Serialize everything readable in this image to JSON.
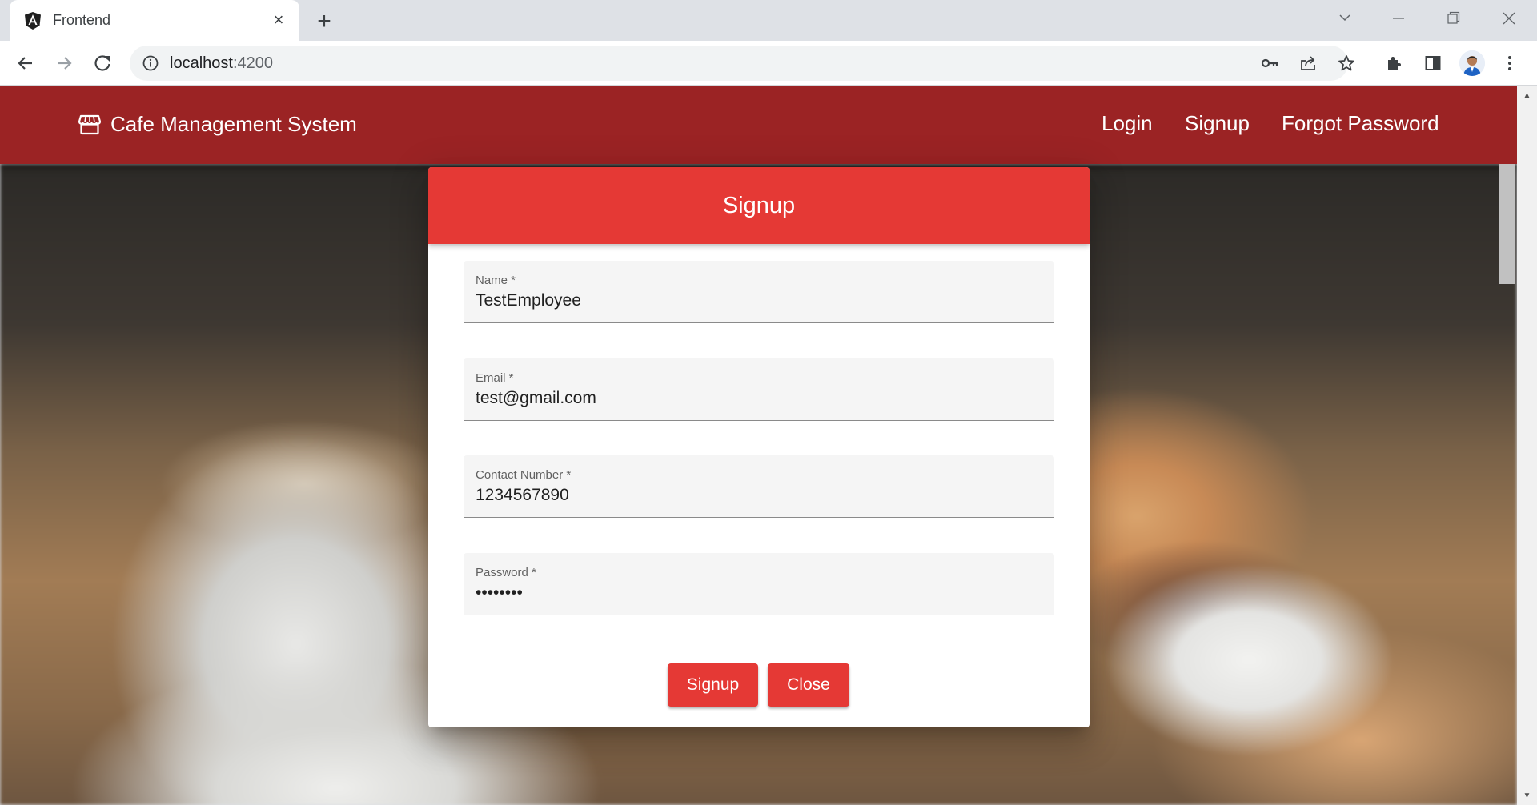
{
  "browser": {
    "tab_title": "Frontend",
    "url_host": "localhost",
    "url_port": ":4200"
  },
  "app": {
    "brand_title": "Cafe Management System",
    "nav": [
      "Login",
      "Signup",
      "Forgot Password"
    ]
  },
  "dialog": {
    "title": "Signup",
    "fields": [
      {
        "label": "Name *",
        "value": "TestEmployee",
        "type": "text"
      },
      {
        "label": "Email *",
        "value": "test@gmail.com",
        "type": "text"
      },
      {
        "label": "Contact Number *",
        "value": "1234567890",
        "type": "text"
      },
      {
        "label": "Password *",
        "value": "••••••••",
        "type": "password"
      }
    ],
    "buttons": {
      "signup": "Signup",
      "close": "Close"
    }
  },
  "colors": {
    "header_bg": "#9b2324",
    "dialog_header_bg": "#e53935",
    "button_bg": "#e53935"
  },
  "icons": {
    "favicon": "angular-icon",
    "brand": "store-icon"
  }
}
